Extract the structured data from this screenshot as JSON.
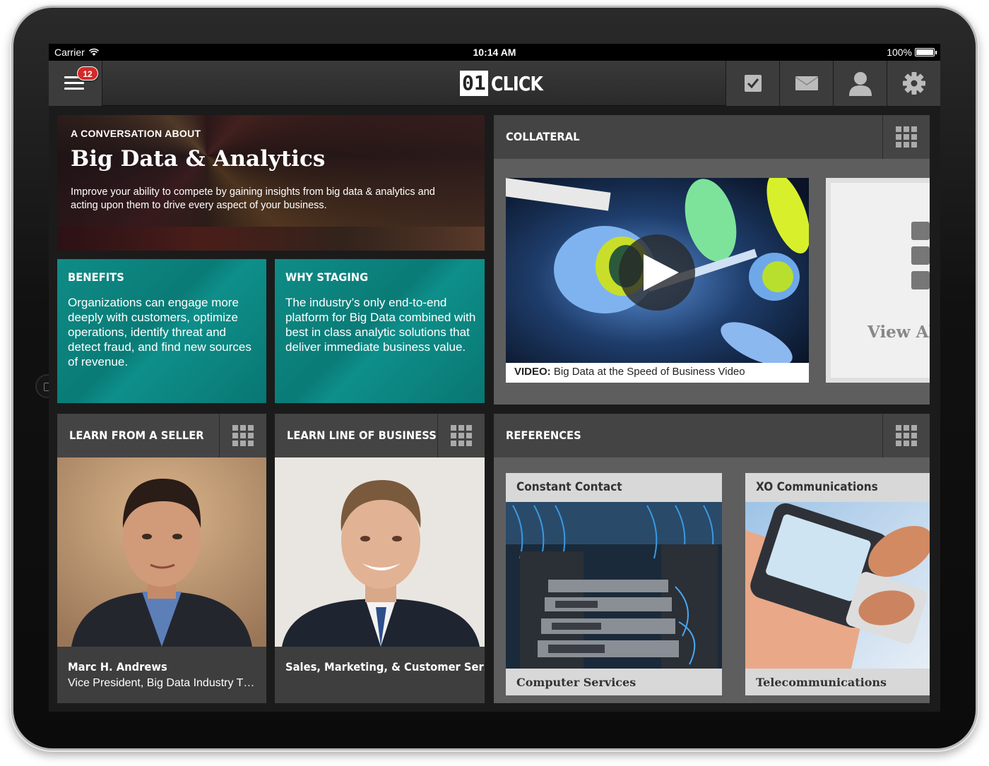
{
  "status_bar": {
    "carrier": "Carrier",
    "time": "10:14 AM",
    "battery": "100%"
  },
  "navbar": {
    "menu_badge": "12",
    "logo_box": "01",
    "logo_word": "CLICK",
    "icons": [
      "checkbox-icon",
      "mail-icon",
      "user-icon",
      "gear-icon"
    ]
  },
  "hero": {
    "eyebrow": "A CONVERSATION ABOUT",
    "title": "Big Data & Analytics",
    "description": "Improve your ability to compete by gaining insights from big data & analytics and acting upon them to drive every aspect of your business."
  },
  "benefits": {
    "title": "BENEFITS",
    "body": "Organizations can engage more deeply with customers, optimize operations, identify threat and detect fraud, and find new sources of revenue."
  },
  "why_staging": {
    "title": "WHY STAGING",
    "body": "The industry’s only end-to-end platform for Big Data combined with best in class analytic solutions that deliver immediate business value."
  },
  "collateral": {
    "title": "COLLATERAL",
    "video_label": "VIDEO:",
    "video_title": "Big Data at the Speed of Business Video",
    "view_all": "View All"
  },
  "learn_seller": {
    "title": "LEARN FROM A SELLER",
    "name": "Marc H. Andrews",
    "role": "Vice President, Big Data Industry T…"
  },
  "learn_lob": {
    "title": "LEARN LINE OF BUSINESS",
    "name": "Sales, Marketing, & Customer Ser…"
  },
  "references": {
    "title": "REFERENCES",
    "cards": [
      {
        "title": "Constant Contact",
        "subtitle": "Computer Services"
      },
      {
        "title": "XO Communications",
        "subtitle": "Telecommunications"
      }
    ]
  },
  "colors": {
    "teal": "#0a7b77",
    "badge_red": "#d42a2a",
    "panel_gray": "#5e5e5e",
    "header_gray": "#444444"
  }
}
